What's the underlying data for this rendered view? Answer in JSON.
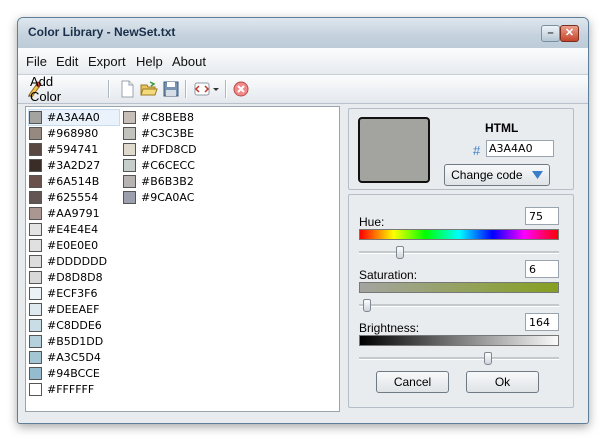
{
  "window": {
    "title": "Color Library - NewSet.txt"
  },
  "menu": [
    "File",
    "Edit",
    "Export",
    "Help",
    "About"
  ],
  "toolbar": {
    "add_color_label": "Add Color",
    "icons": [
      "add-color-icon",
      "new-file-icon",
      "open-folder-icon",
      "save-icon",
      "export-icon",
      "dropdown-arrow-icon",
      "delete-icon"
    ]
  },
  "colors": {
    "col1": [
      "#A3A4A0",
      "#968980",
      "#594741",
      "#3A2D27",
      "#6A514B",
      "#625554",
      "#AA9791",
      "#E4E4E4",
      "#E0E0E0",
      "#DDDDDD",
      "#D8D8D8",
      "#ECF3F6",
      "#DEEAEF",
      "#C8DDE6",
      "#B5D1DD",
      "#A3C5D4",
      "#94BCCE",
      "#FFFFFF"
    ],
    "col2": [
      "#C8BEB8",
      "#C3C3BE",
      "#DFD8CD",
      "#C6CECC",
      "#B6B3B2",
      "#9CA0AC"
    ],
    "selected": "#A3A4A0"
  },
  "editor": {
    "heading": "HTML",
    "hash": "#",
    "code": "A3A4A0",
    "change_code": "Change code",
    "hue_label": "Hue:",
    "hue": "75",
    "saturation_label": "Saturation:",
    "saturation": "6",
    "brightness_label": "Brightness:",
    "brightness": "164",
    "hue_fraction": 0.2,
    "saturation_fraction": 0.02,
    "brightness_fraction": 0.64,
    "cancel": "Cancel",
    "ok": "Ok"
  }
}
